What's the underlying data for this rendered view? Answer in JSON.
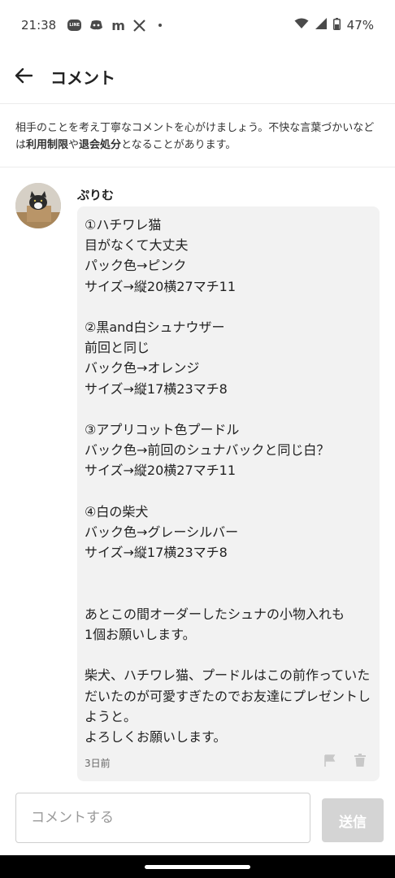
{
  "status_bar": {
    "time": "21:38",
    "notification_icons": [
      "line-icon",
      "discord-icon",
      "m-icon",
      "x-icon",
      "dot-icon"
    ],
    "line_badge": "LINE",
    "m_label": "m",
    "battery": "47%"
  },
  "app_bar": {
    "title": "コメント"
  },
  "notice": {
    "part1": "相手のことを考え丁寧なコメントを心がけましょう。不快な言葉づかいなどは",
    "bold1": "利用制限",
    "part2": "や",
    "bold2": "退会処分",
    "part3": "となることがあります。"
  },
  "comment": {
    "username": "ぷりむ",
    "body": "①ハチワレ猫\n目がなくて大丈夫\nパック色→ピンク\nサイズ→縦20横27マチ11\n\n②黒and白シュナウザー\n前回と同じ\nバック色→オレンジ\nサイズ→縦17横23マチ8\n\n③アプリコット色プードル\nバック色→前回のシュナバックと同じ白？\nサイズ→縦20横27マチ11\n\n④白の柴犬\nバック色→グレーシルバー\nサイズ→縦17横23マチ8\n\n\nあとこの間オーダーしたシュナの小物入れも\n1個お願いします。\n\n柴犬、ハチワレ猫、プードルはこの前作っていただいたのが可愛すぎたのでお友達にプレゼントしようと。\nよろしくお願いします。",
    "timestamp": "3日前"
  },
  "input": {
    "placeholder": "コメントする",
    "value": ""
  },
  "send_button": {
    "label": "送信"
  },
  "colors": {
    "bubble_bg": "#f2f2f2",
    "send_disabled": "#d4d4d4",
    "text": "#222222",
    "muted_icon": "#c8c8c8"
  }
}
